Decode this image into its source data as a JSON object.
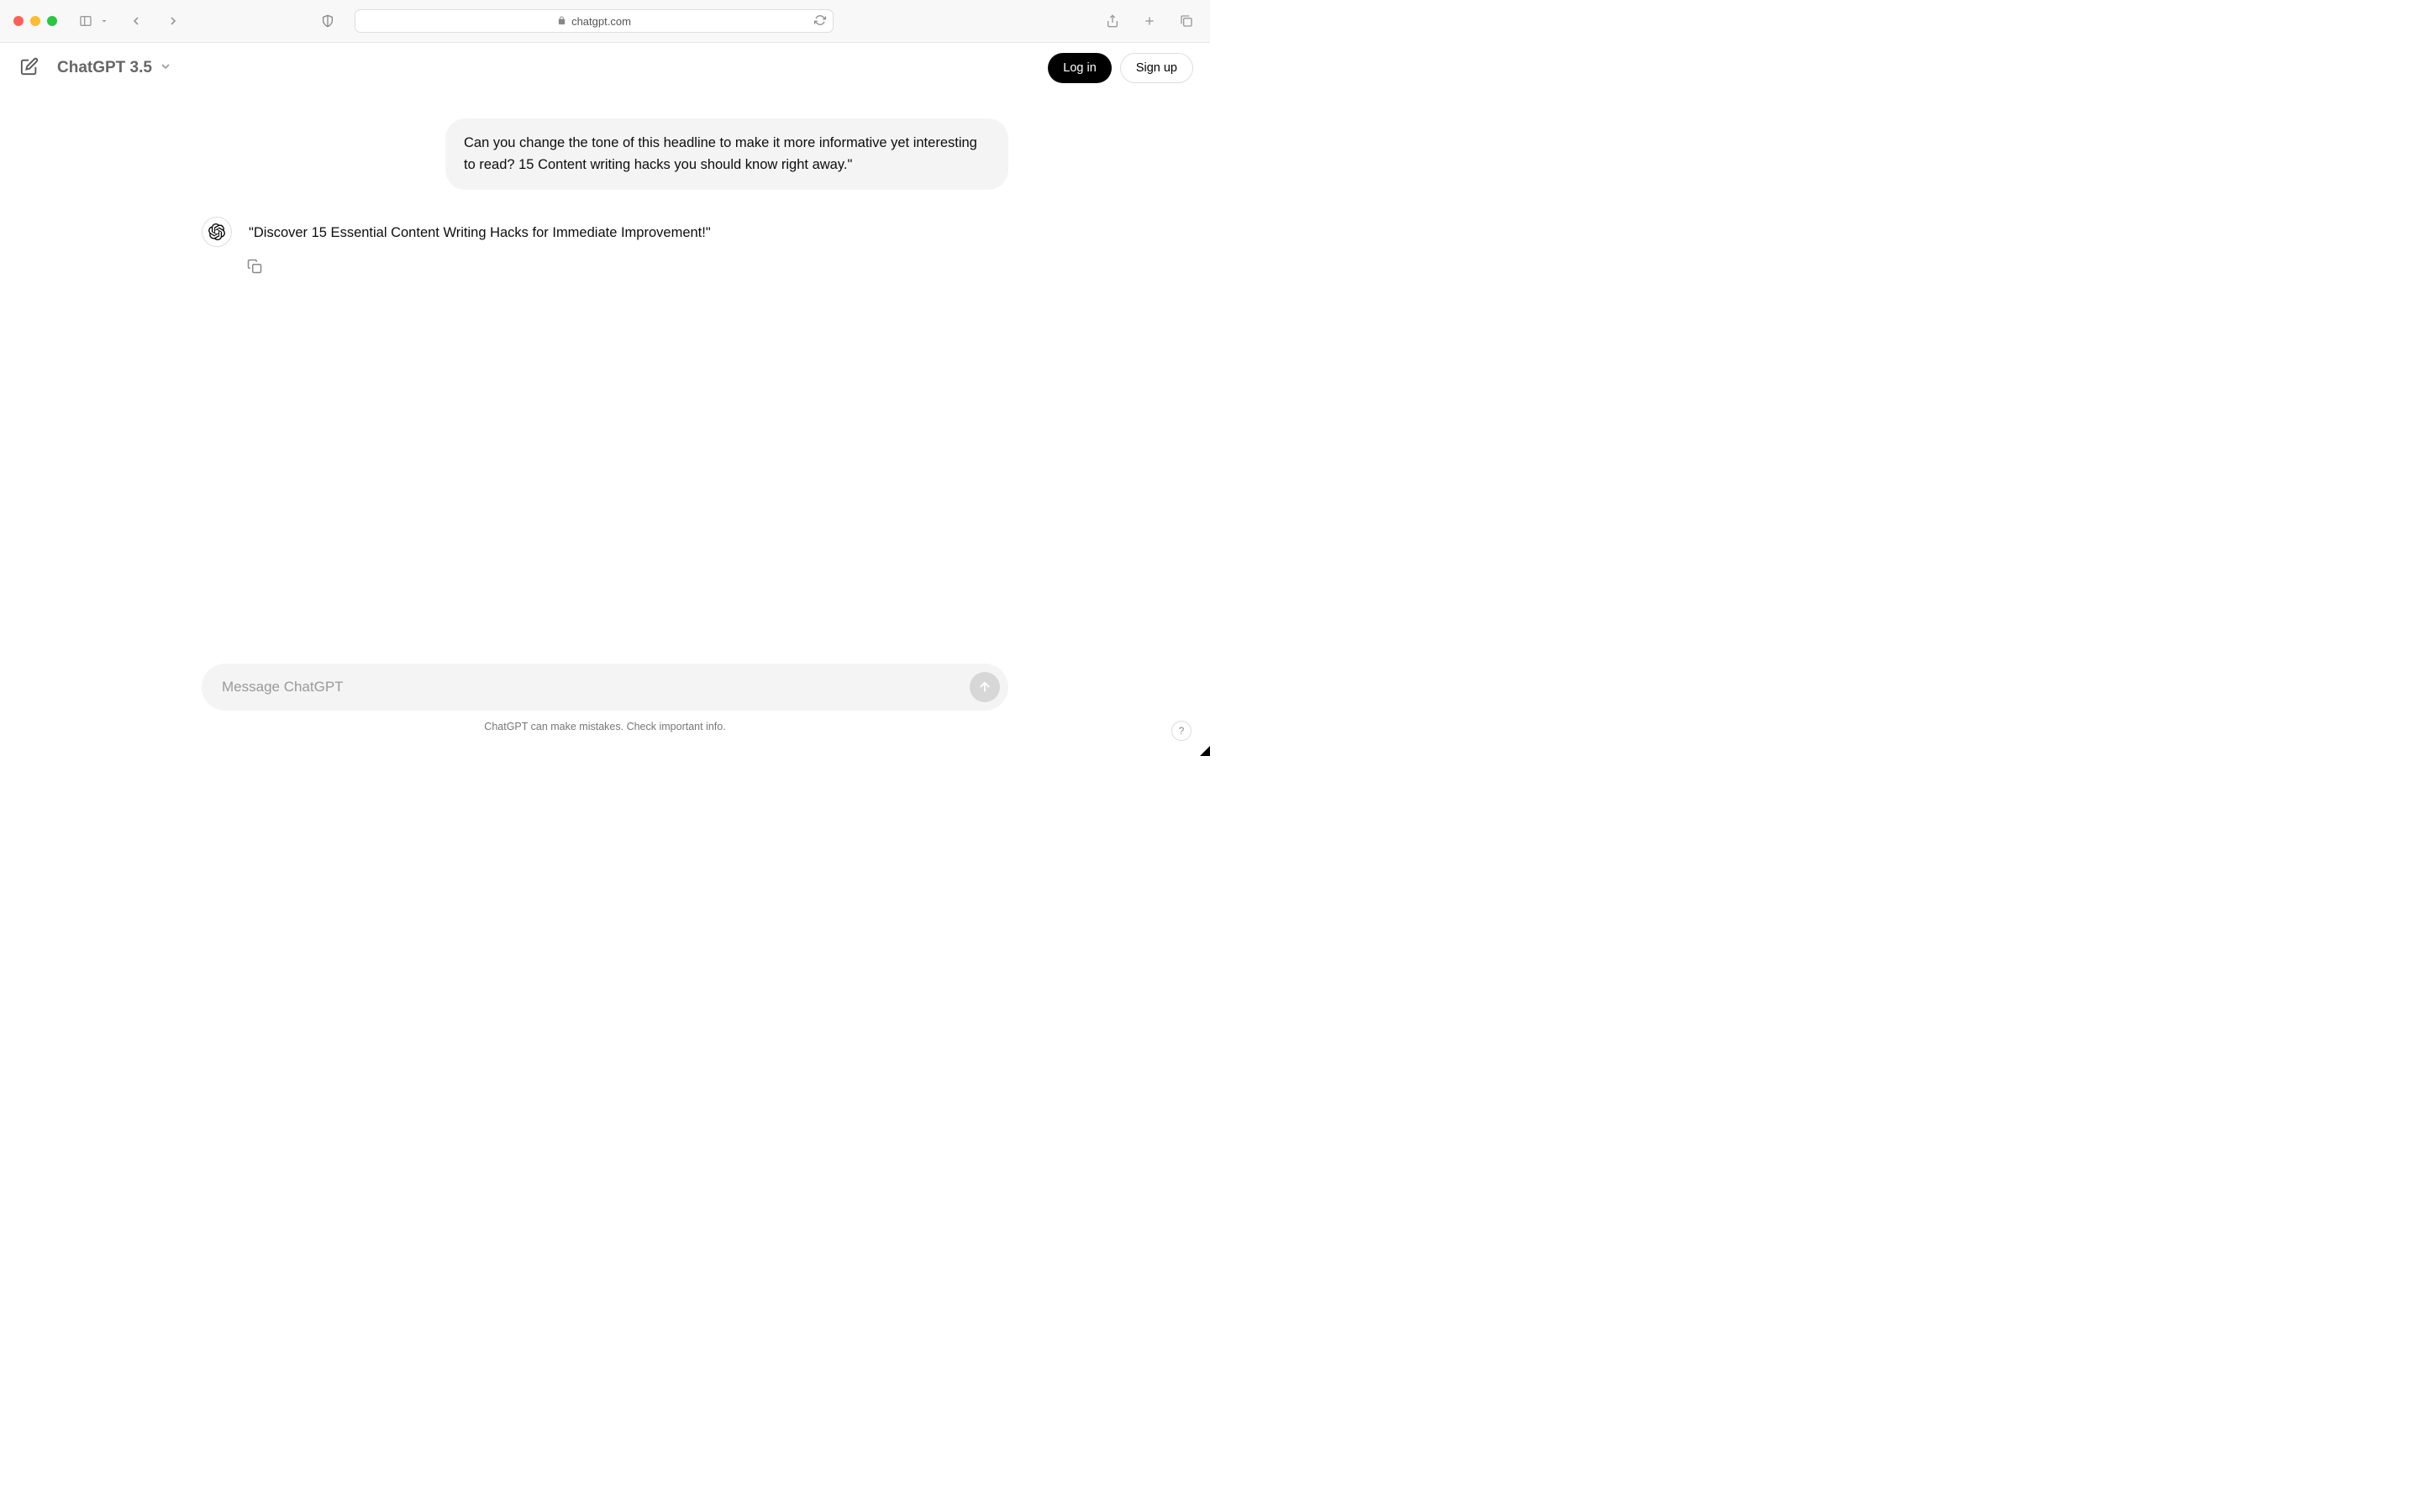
{
  "browser": {
    "url": "chatgpt.com"
  },
  "header": {
    "model": "ChatGPT 3.5",
    "login": "Log in",
    "signup": "Sign up"
  },
  "chat": {
    "user_message": "Can you change the tone of this headline to make it more informative yet interesting to read? 15 Content writing hacks you should know right away.\"",
    "assistant_message": "\"Discover 15 Essential Content Writing Hacks for Immediate Improvement!\""
  },
  "input": {
    "placeholder": "Message ChatGPT"
  },
  "footer": {
    "disclaimer": "ChatGPT can make mistakes. Check important info."
  },
  "help": {
    "label": "?"
  }
}
